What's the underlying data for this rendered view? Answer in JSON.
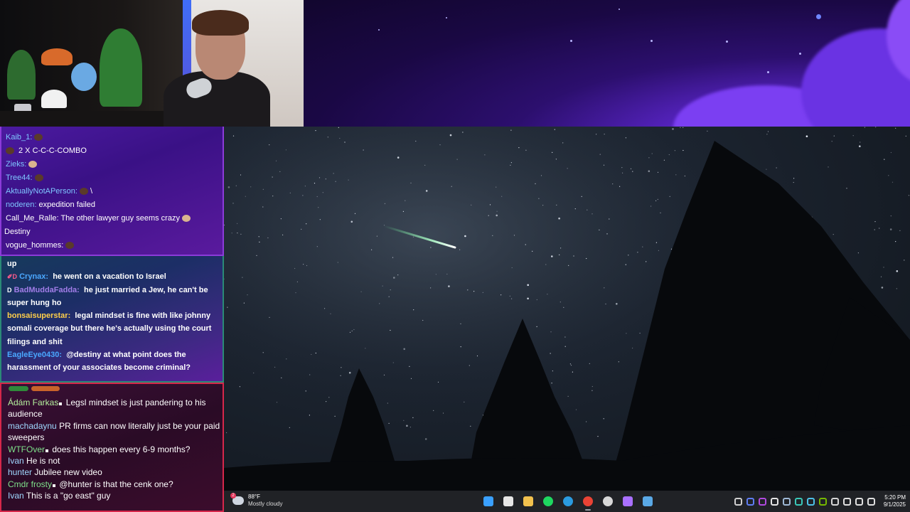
{
  "chat_overlay_top": {
    "messages": [
      {
        "user": "Kaib_1:",
        "text": "",
        "color": "#7fc6ff"
      },
      {
        "user": "",
        "text": "2 X C-C-C-COMBO",
        "color": "#ffffff"
      },
      {
        "user": "Zieks:",
        "text": "",
        "color": "#7fc6ff"
      },
      {
        "user": "Tree44:",
        "text": "",
        "color": "#7fc6ff"
      },
      {
        "user": "AktuallyNotAPerson:",
        "text": "\\",
        "color": "#7fc6ff"
      },
      {
        "user": "noderen:",
        "text": "expedition failed",
        "color": "#7fc6ff"
      },
      {
        "user": "Call_Me_Ralle:",
        "text": "The other lawyer guy seems crazy",
        "color": "#ffffff"
      },
      {
        "user": "Destiny",
        "text": "",
        "color": "#ffffff"
      },
      {
        "user": "vogue_hommes:",
        "text": "",
        "color": "#ffffff"
      }
    ]
  },
  "chat_overlay_middle": {
    "messages": [
      {
        "badge": "",
        "user": "",
        "text": "up",
        "color": "#ffffff"
      },
      {
        "badge": "✐D",
        "user": "Crynax:",
        "text": "he went on a vacation to Israel",
        "color": "#4aa8ff"
      },
      {
        "badge": "D",
        "user": "BadMuddaFadda:",
        "text": "he just married a Jew, he can't be super hung ho",
        "color": "#a27de8"
      },
      {
        "badge": "",
        "user": "bonsaisuperstar:",
        "text": "legal mindset is fine with like johnny somali coverage but there he's actually using the court filings and shit",
        "color": "#ffcf4a"
      },
      {
        "badge": "",
        "user": "EagleEye0430:",
        "text": "@destiny at what point does the harassment of your associates become criminal?",
        "color": "#4aa8ff"
      }
    ]
  },
  "chat_overlay_bottom": {
    "messages": [
      {
        "user": "Ádám Farkas",
        "text": "Legsl mindset is just pandering to his audience",
        "dot": true,
        "color_class": "grn"
      },
      {
        "user": "machadaynu",
        "text": "PR firms can now literally just be your paid sweepers",
        "dot": false,
        "color_class": ""
      },
      {
        "user": "WTFOver",
        "text": "does this happen every 6-9 months?",
        "dot": true,
        "color_class": "green"
      },
      {
        "user": "Ivan",
        "text": "He is not",
        "dot": false,
        "color_class": ""
      },
      {
        "user": "hunter",
        "text": "Jubilee new video",
        "dot": false,
        "color_class": ""
      },
      {
        "user": "Cmdr frosty",
        "text": "@hunter is that the cenk one?",
        "dot": true,
        "color_class": "green"
      },
      {
        "user": "Ivan",
        "text": "This is a \"go east\" guy",
        "dot": false,
        "color_class": ""
      }
    ]
  },
  "taskbar": {
    "weather": {
      "alert_count": "2",
      "temperature": "88°F",
      "condition": "Mostly cloudy"
    },
    "apps": [
      {
        "name": "windows-start-icon",
        "color": "#3aa0ff",
        "active": false
      },
      {
        "name": "task-view-icon",
        "color": "#e6e6e6",
        "active": false
      },
      {
        "name": "file-explorer-icon",
        "color": "#f2c14e",
        "active": false
      },
      {
        "name": "spotify-icon",
        "color": "#1ed760",
        "active": false
      },
      {
        "name": "edge-icon",
        "color": "#2b9be0",
        "active": false
      },
      {
        "name": "chrome-icon",
        "color": "#ea4335",
        "active": true
      },
      {
        "name": "obs-icon",
        "color": "#d8d8d8",
        "active": false
      },
      {
        "name": "twitch-icon",
        "color": "#a970ff",
        "active": false
      },
      {
        "name": "steam-icon",
        "color": "#5aa9e6",
        "active": false
      }
    ],
    "tray": [
      {
        "name": "chevron-up-icon",
        "color": "#d0d0d0"
      },
      {
        "name": "bolt-icon",
        "color": "#5f7df3"
      },
      {
        "name": "tray-app-purple-icon",
        "color": "#b04ae0"
      },
      {
        "name": "tray-app-white-icon",
        "color": "#e5e5e5"
      },
      {
        "name": "steam-tray-icon",
        "color": "#9fb9d6"
      },
      {
        "name": "refresh-icon",
        "color": "#3ac8b8"
      },
      {
        "name": "cloud-tray-icon",
        "color": "#4dc0e6"
      },
      {
        "name": "nvidia-icon",
        "color": "#76b900"
      },
      {
        "name": "shield-tray-icon",
        "color": "#d6d6d6"
      },
      {
        "name": "network-icon",
        "color": "#e0e0e0"
      },
      {
        "name": "volume-icon",
        "color": "#e0e0e0"
      },
      {
        "name": "battery-icon",
        "color": "#e0e0e0"
      }
    ],
    "clock": {
      "time": "5:20 PM",
      "date": "9/1/2025"
    }
  }
}
